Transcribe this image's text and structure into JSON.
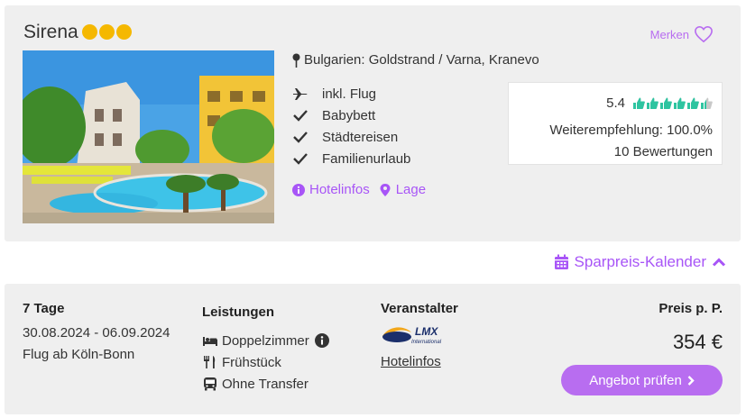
{
  "hotel": {
    "name": "Sirena",
    "stars": 3,
    "merken_label": "Merken",
    "location": "Bulgarien: Goldstrand / Varna, Kranevo",
    "features": [
      "inkl. Flug",
      "Babybett",
      "Städtereisen",
      "Familienurlaub"
    ],
    "links": {
      "hotelinfos": "Hotelinfos",
      "lage": "Lage"
    }
  },
  "rating": {
    "score": "5.4",
    "thumbs_filled": 5.5,
    "thumbs_total": 6,
    "recommendation": "Weiterempfehlung: 100.0%",
    "reviews": "10 Bewertungen"
  },
  "calendar": {
    "label": "Sparpreis-Kalender"
  },
  "offer": {
    "duration": "7 Tage",
    "dates": "30.08.2024 - 06.09.2024",
    "flight": "Flug ab Köln-Bonn",
    "services_title": "Leistungen",
    "services": [
      "Doppelzimmer",
      "Frühstück",
      "Ohne Transfer"
    ],
    "operator_title": "Veranstalter",
    "operator_logo_text": "LMX",
    "operator_logo_subtext": "International",
    "operator_link": "Hotelinfos",
    "price_label": "Preis p. P.",
    "price": "354 €",
    "cta_label": "Angebot prüfen"
  },
  "colors": {
    "accent": "#a855f7",
    "button": "#b86df0",
    "star": "#f5b800",
    "thumb": "#2ec4a0",
    "panel": "#efefef"
  }
}
